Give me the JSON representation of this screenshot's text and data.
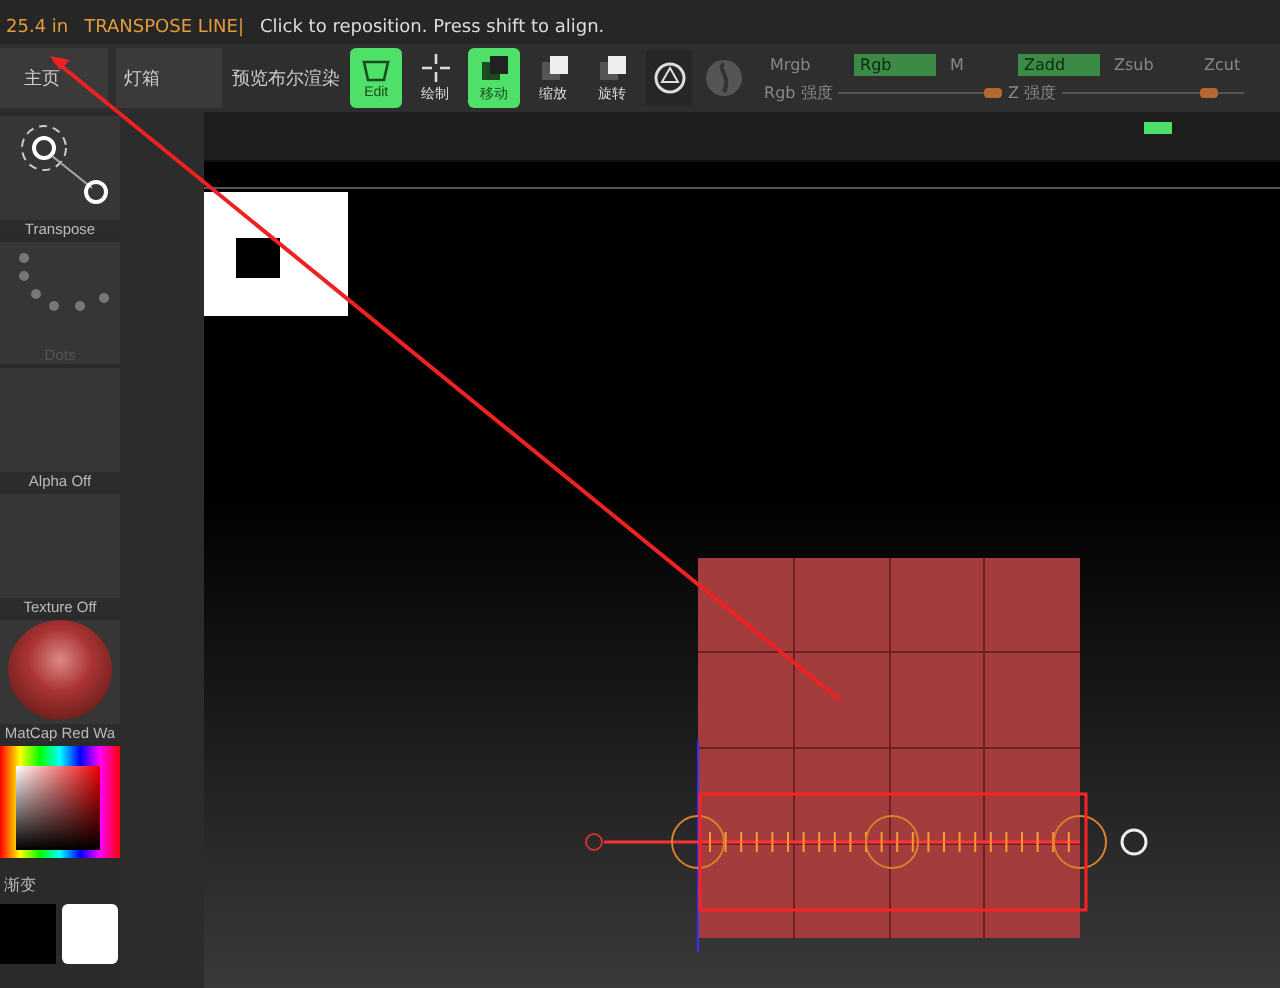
{
  "status": {
    "value": "25.4 in",
    "mode": "TRANSPOSE LINE|",
    "hint": "Click to reposition. Press shift to align."
  },
  "tabs": [
    {
      "label": "主页",
      "kind": "box"
    },
    {
      "label": "灯箱",
      "kind": "box"
    },
    {
      "label": "预览布尔渲染",
      "kind": "plain"
    }
  ],
  "tools": [
    {
      "label": "Edit",
      "kind": "edit",
      "active": true
    },
    {
      "label": "绘制",
      "kind": "draw",
      "active": false
    },
    {
      "label": "移动",
      "kind": "move",
      "active": true
    },
    {
      "label": "缩放",
      "kind": "scale",
      "active": false
    },
    {
      "label": "旋转",
      "kind": "rotate",
      "active": false
    }
  ],
  "modes": [
    {
      "label": "Mrgb",
      "on": false
    },
    {
      "label": "Rgb",
      "on": true
    },
    {
      "label": "M",
      "on": false
    },
    {
      "label": "Zadd",
      "on": true
    },
    {
      "label": "Zsub",
      "on": false
    },
    {
      "label": "Zcut",
      "on": false
    }
  ],
  "sliders": [
    {
      "label": "Rgb 强度",
      "level": 0.95
    },
    {
      "label": "Z 强度",
      "level": 0.8
    }
  ],
  "palette": [
    {
      "label": "Transpose",
      "kind": "transpose"
    },
    {
      "label": "Dots",
      "kind": "dots"
    },
    {
      "label": "Alpha Off",
      "kind": "empty"
    },
    {
      "label": "Texture Off",
      "kind": "empty"
    },
    {
      "label": "MatCap Red Wa",
      "kind": "material"
    }
  ],
  "color": {
    "label": "渐变"
  }
}
